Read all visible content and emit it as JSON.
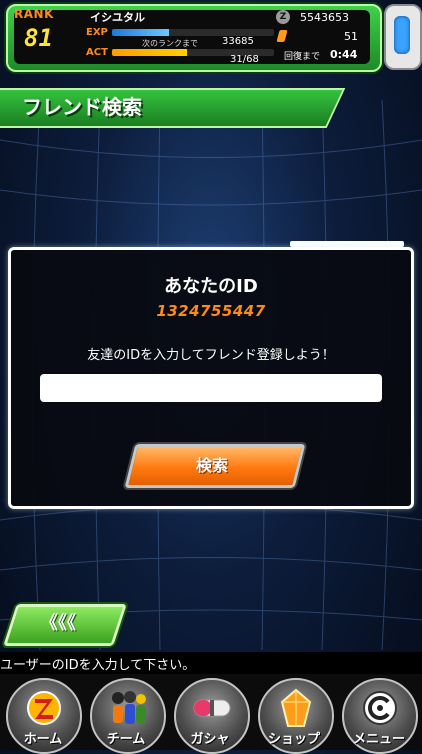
{
  "hud": {
    "rank_label": "RANK",
    "rank": "81",
    "player_name": "イシユタル",
    "exp_label": "EXP",
    "next_rank_label": "次のランクまで",
    "exp_to_next": "33685",
    "exp_fill_fraction": 0.35,
    "act_label": "ACT",
    "act": "31/68",
    "act_fill_fraction": 0.46,
    "zeni_icon": "Z",
    "zeni": "5543653",
    "dragon_stones": "51",
    "recover_label": "回復まで",
    "recover_time": "0:44"
  },
  "page_title": "フレンド検索",
  "panel": {
    "your_id_label": "あなたのID",
    "your_id": "1324755447",
    "prompt": "友達のIDを入力してフレンド登録しよう！",
    "input_value": "",
    "search_label": "検索"
  },
  "back_label": "《《《",
  "hint": "ユーザーのIDを入力して下さい。",
  "nav": [
    {
      "label": "ホーム",
      "icon": "z-logo-icon"
    },
    {
      "label": "チーム",
      "icon": "team-characters-icon"
    },
    {
      "label": "ガシャ",
      "icon": "capsule-icon"
    },
    {
      "label": "ショップ",
      "icon": "dragon-stone-icon"
    },
    {
      "label": "メニュー",
      "icon": "capsule-corp-icon"
    }
  ]
}
